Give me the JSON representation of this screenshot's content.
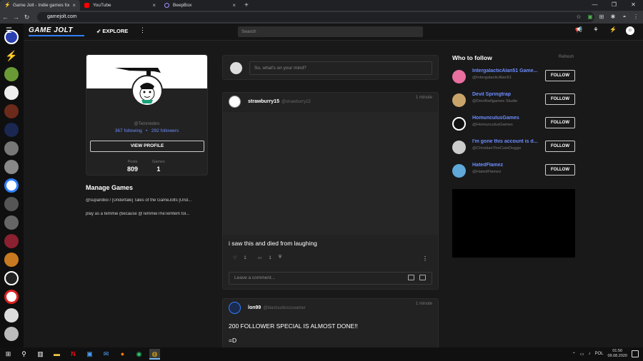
{
  "browser": {
    "tabs": [
      {
        "title": "Game Jolt - Indie games for the love",
        "active": true
      },
      {
        "title": "YouTube",
        "active": false
      },
      {
        "title": "BeepBox",
        "active": false
      }
    ],
    "new_tab": "+",
    "url": "gamejolt.com"
  },
  "site": {
    "logo": "GAME JOLT",
    "explore_label": "EXPLORE",
    "search_placeholder": "Search"
  },
  "profile": {
    "handle": "@Temmiebro",
    "following_count": "367",
    "following_label": "following",
    "followers_count": "292",
    "followers_label": "followers",
    "view_profile_label": "VIEW PROFILE",
    "posts_label": "Posts",
    "posts_value": "809",
    "games_label": "Games",
    "games_value": "1"
  },
  "manage_games": {
    "title": "Manage Games",
    "items": [
      "@supaniboi / [Undertale] Tales of the GameJolts [Und...",
      "play as a temmie (because @TemmieTheTemtem tol..."
    ]
  },
  "composer": {
    "placeholder": "So, what's on your mind?"
  },
  "posts": [
    {
      "username": "strawburry15",
      "at": "@strawburry15",
      "time": "1 minute",
      "text": "i saw this and died from laughing",
      "likes": "1",
      "comments": "1",
      "comment_placeholder": "Leave a comment..."
    },
    {
      "username": "lon99",
      "at": "@blastsudioszooamer",
      "time": "1 minute",
      "text": "200 FOLLOWER SPECIAL IS ALMOST DONE!!",
      "text2": "=D"
    }
  ],
  "who_to_follow": {
    "title": "Who to follow",
    "refresh": "Refresh",
    "follow_label": "FOLLOW",
    "users": [
      {
        "name": "IntergalacticAlan51 Game...",
        "handle": "@IntergalacticAlan51",
        "color": "#e86fa0"
      },
      {
        "name": "Devil Springtrap",
        "handle": "@Devilhellgames Studio",
        "color": "#c9a46a"
      },
      {
        "name": "HomunculusGames",
        "handle": "@HomunculusGames",
        "color": "#111111"
      },
      {
        "name": "I'm gone this account is d...",
        "handle": "@ChristianTheCuteDoggo",
        "color": "#cccccc"
      },
      {
        "name": "HatedFlamez",
        "handle": "@HatedFlamez",
        "color": "#5fa8d8"
      }
    ]
  },
  "taskbar": {
    "language": "POL",
    "time": "01:50",
    "date": "09.08.2020"
  },
  "colors": {
    "accent": "#2f7fff",
    "link": "#6c8dff",
    "background": "#191919",
    "card": "#222222"
  }
}
